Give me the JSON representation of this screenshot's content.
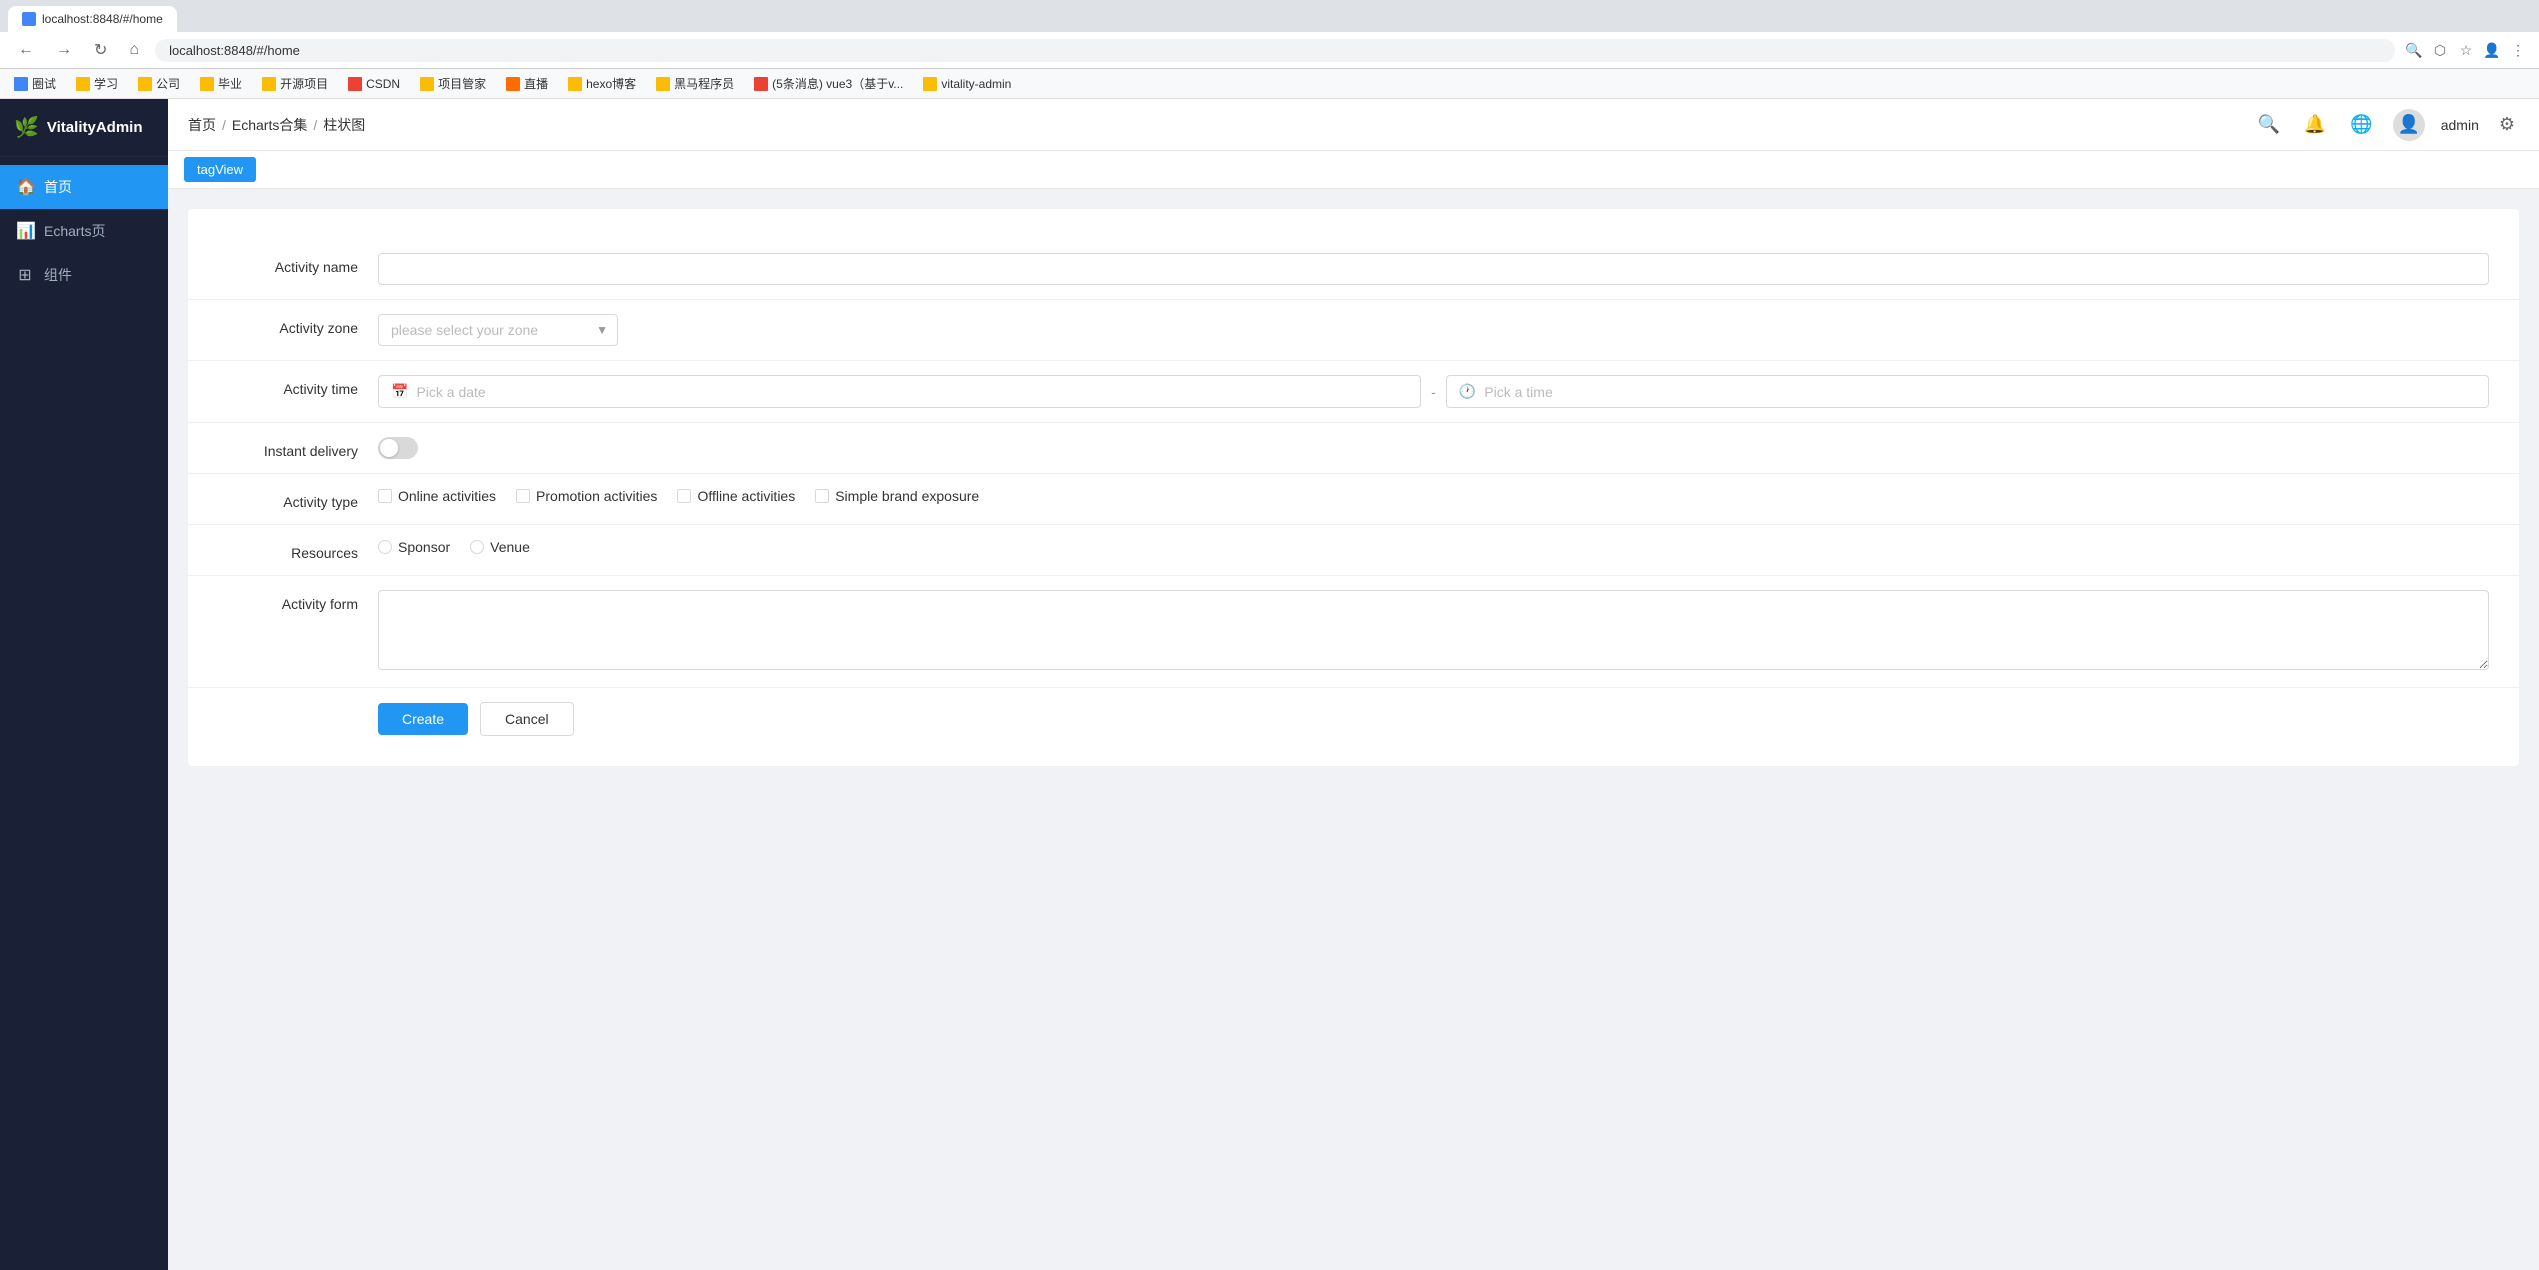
{
  "browser": {
    "url": "localhost:8848/#/home",
    "tab_label": "localhost:8848/#/home"
  },
  "bookmarks": [
    {
      "label": "圈试",
      "color": "blue"
    },
    {
      "label": "学习",
      "color": "yellow"
    },
    {
      "label": "公司",
      "color": "yellow"
    },
    {
      "label": "毕业",
      "color": "yellow"
    },
    {
      "label": "开源项目",
      "color": "yellow"
    },
    {
      "label": "CSDN",
      "color": "red"
    },
    {
      "label": "项目管家",
      "color": "yellow"
    },
    {
      "label": "直播",
      "color": "orange"
    },
    {
      "label": "hexo博客",
      "color": "yellow"
    },
    {
      "label": "黑马程序员",
      "color": "yellow"
    },
    {
      "label": "(5条消息) vue3（基于v...",
      "color": "red"
    },
    {
      "label": "vitality-admin",
      "color": "yellow"
    }
  ],
  "sidebar": {
    "logo": "🌿",
    "logo_text": "VitalityAdmin",
    "items": [
      {
        "label": "首页",
        "icon": "🏠",
        "active": true
      },
      {
        "label": "Echarts页",
        "icon": "📊",
        "active": false
      },
      {
        "label": "组件",
        "icon": "⊞",
        "active": false
      }
    ]
  },
  "header": {
    "breadcrumbs": [
      "首页",
      "Echarts合集",
      "柱状图"
    ],
    "username": "admin"
  },
  "tagview": {
    "tag_label": "tagView"
  },
  "form": {
    "activity_name_label": "Activity name",
    "activity_zone_label": "Activity zone",
    "activity_zone_placeholder": "please select your zone",
    "activity_time_label": "Activity time",
    "date_placeholder": "Pick a date",
    "time_placeholder": "Pick a time",
    "instant_delivery_label": "Instant delivery",
    "activity_type_label": "Activity type",
    "activity_types": [
      {
        "label": "Online activities"
      },
      {
        "label": "Promotion activities"
      },
      {
        "label": "Offline activities"
      },
      {
        "label": "Simple brand exposure"
      }
    ],
    "resources_label": "Resources",
    "resources": [
      {
        "label": "Sponsor"
      },
      {
        "label": "Venue"
      }
    ],
    "activity_form_label": "Activity form",
    "create_button": "Create",
    "cancel_button": "Cancel"
  }
}
